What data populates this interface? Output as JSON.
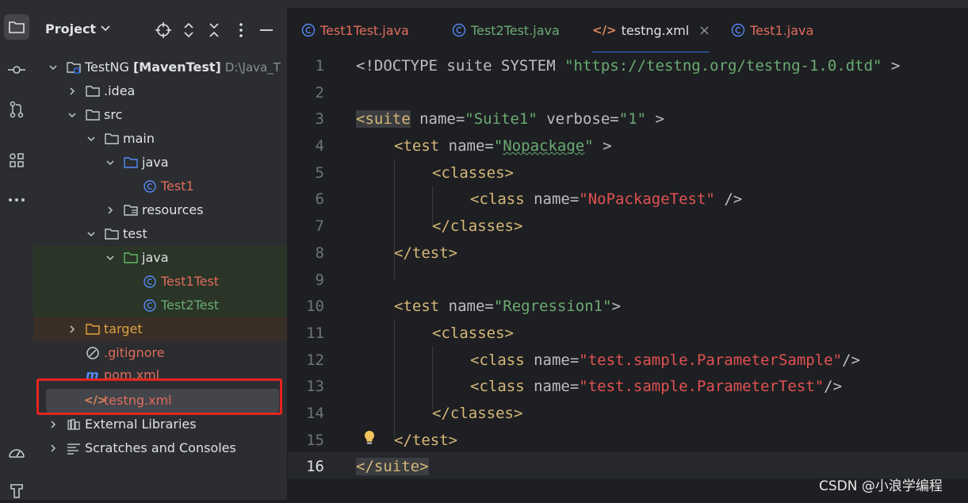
{
  "project_panel": {
    "title": "Project",
    "tree": [
      {
        "label": "TestNG",
        "bold_suffix": "[MavenTest]",
        "path": "D:\\Java_T",
        "icon": "module-folder-icon"
      },
      {
        "label": ".idea",
        "icon": "folder-icon"
      },
      {
        "label": "src",
        "icon": "folder-icon"
      },
      {
        "label": "main",
        "icon": "folder-icon"
      },
      {
        "label": "java",
        "icon": "source-folder-icon"
      },
      {
        "label": "Test1",
        "icon": "class-icon"
      },
      {
        "label": "resources",
        "icon": "resources-folder-icon"
      },
      {
        "label": "test",
        "icon": "folder-icon"
      },
      {
        "label": "java",
        "icon": "test-folder-icon"
      },
      {
        "label": "Test1Test",
        "icon": "class-icon"
      },
      {
        "label": "Test2Test",
        "icon": "class-icon"
      },
      {
        "label": "target",
        "icon": "excluded-folder-icon"
      },
      {
        "label": ".gitignore",
        "icon": "ignore-file-icon"
      },
      {
        "label": "pom.xml",
        "icon": "maven-icon"
      },
      {
        "label": "testng.xml",
        "icon": "xml-file-icon"
      },
      {
        "label": "External Libraries",
        "icon": "library-icon"
      },
      {
        "label": "Scratches and Consoles",
        "icon": "scratches-icon"
      }
    ]
  },
  "tabs": [
    {
      "label": "Test1Test.java",
      "icon": "class-icon"
    },
    {
      "label": "Test2Test.java",
      "icon": "class-icon"
    },
    {
      "label": "testng.xml",
      "icon": "xml-file-icon",
      "active": true,
      "close": "×"
    },
    {
      "label": "Test1.java",
      "icon": "class-icon"
    }
  ],
  "editor": {
    "line_numbers": [
      "1",
      "2",
      "3",
      "4",
      "5",
      "6",
      "7",
      "8",
      "9",
      "10",
      "11",
      "12",
      "13",
      "14",
      "15",
      "16"
    ],
    "current_line": "16",
    "code": {
      "l1": {
        "a": "<!DOCTYPE suite SYSTEM ",
        "b": "\"https://testng.org/testng-1.0.dtd\"",
        "c": " >"
      },
      "l3": {
        "a": "<suite",
        "b": " name=",
        "c": "\"Suite1\"",
        "d": " verbose=",
        "e": "\"1\"",
        "f": " >"
      },
      "l4": {
        "a": "<test",
        "b": " name=",
        "c": "\"",
        "d": "Nopackage",
        "e": "\"",
        "f": " >"
      },
      "l5": {
        "a": "<classes>"
      },
      "l6": {
        "a": "<class",
        "b": " name=",
        "c": "\"NoPackageTest\"",
        "d": " />"
      },
      "l7": {
        "a": "</classes>"
      },
      "l8": {
        "a": "</test>"
      },
      "l10": {
        "a": "<test",
        "b": " name=",
        "c": "\"Regression1\"",
        "d": ">"
      },
      "l11": {
        "a": "<classes>"
      },
      "l12": {
        "a": "<class",
        "b": " name=",
        "c": "\"test.sample.ParameterSample\"",
        "d": "/>"
      },
      "l13": {
        "a": "<class",
        "b": " name=",
        "c": "\"test.sample.ParameterTest\"",
        "d": "/>"
      },
      "l14": {
        "a": "</classes>"
      },
      "l15": {
        "a": "</test>"
      },
      "l16": {
        "a": "</suite>"
      }
    }
  },
  "watermark": "CSDN @小浪学编程",
  "colors": {
    "accent": "#3574f0",
    "highlight_box": "#e8231f",
    "string": "#6aab73",
    "tag": "#d5b778",
    "error_red": "#e05252"
  }
}
